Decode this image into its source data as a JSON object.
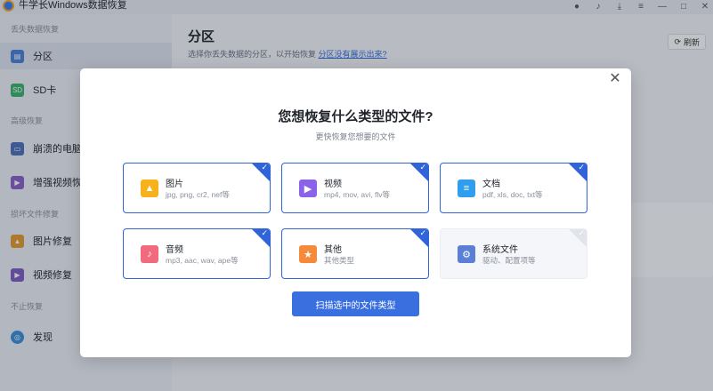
{
  "app": {
    "title": "牛学长Windows数据恢复"
  },
  "sidebar": {
    "groups": [
      {
        "label": "丢失数据恢复"
      },
      {
        "label": "高级恢复"
      },
      {
        "label": "损坏文件修复"
      },
      {
        "label": "不止恢复"
      }
    ],
    "items": [
      {
        "label": "分区",
        "icon": "partition-icon"
      },
      {
        "label": "SD卡",
        "icon": "sd-card-icon"
      },
      {
        "label": "崩溃的电脑",
        "icon": "crashed-pc-icon"
      },
      {
        "label": "增强视频恢",
        "icon": "enhanced-video-icon"
      },
      {
        "label": "图片修复",
        "icon": "photo-repair-icon"
      },
      {
        "label": "视频修复",
        "icon": "video-repair-icon"
      },
      {
        "label": "发现",
        "icon": "discover-icon"
      }
    ]
  },
  "main": {
    "title": "分区",
    "subtitle": "选择你丢失数据的分区，以开始恢复",
    "subtitle_link": "分区没有展示出来?",
    "refresh_label": "刷新"
  },
  "modal": {
    "title": "您想恢复什么类型的文件?",
    "subtitle": "更快恢复您想要的文件",
    "scan_label": "扫描选中的文件类型",
    "types": [
      {
        "name": "图片",
        "desc": "jpg, png, cr2, nef等",
        "icon": "image-icon",
        "color": "#f7b21b",
        "selected": true
      },
      {
        "name": "视频",
        "desc": "mp4, mov, avi, flv等",
        "icon": "video-icon",
        "color": "#8a63e8",
        "selected": true
      },
      {
        "name": "文档",
        "desc": "pdf, xls, doc, txt等",
        "icon": "document-icon",
        "color": "#2f9ef0",
        "selected": true
      },
      {
        "name": "音频",
        "desc": "mp3, aac, wav, ape等",
        "icon": "audio-icon",
        "color": "#f26a7e",
        "selected": true
      },
      {
        "name": "其他",
        "desc": "其他类型",
        "icon": "other-icon",
        "color": "#f58a3a",
        "selected": true
      },
      {
        "name": "系统文件",
        "desc": "驱动、配置项等",
        "icon": "system-file-icon",
        "color": "#5b7fd4",
        "selected": false
      }
    ]
  }
}
